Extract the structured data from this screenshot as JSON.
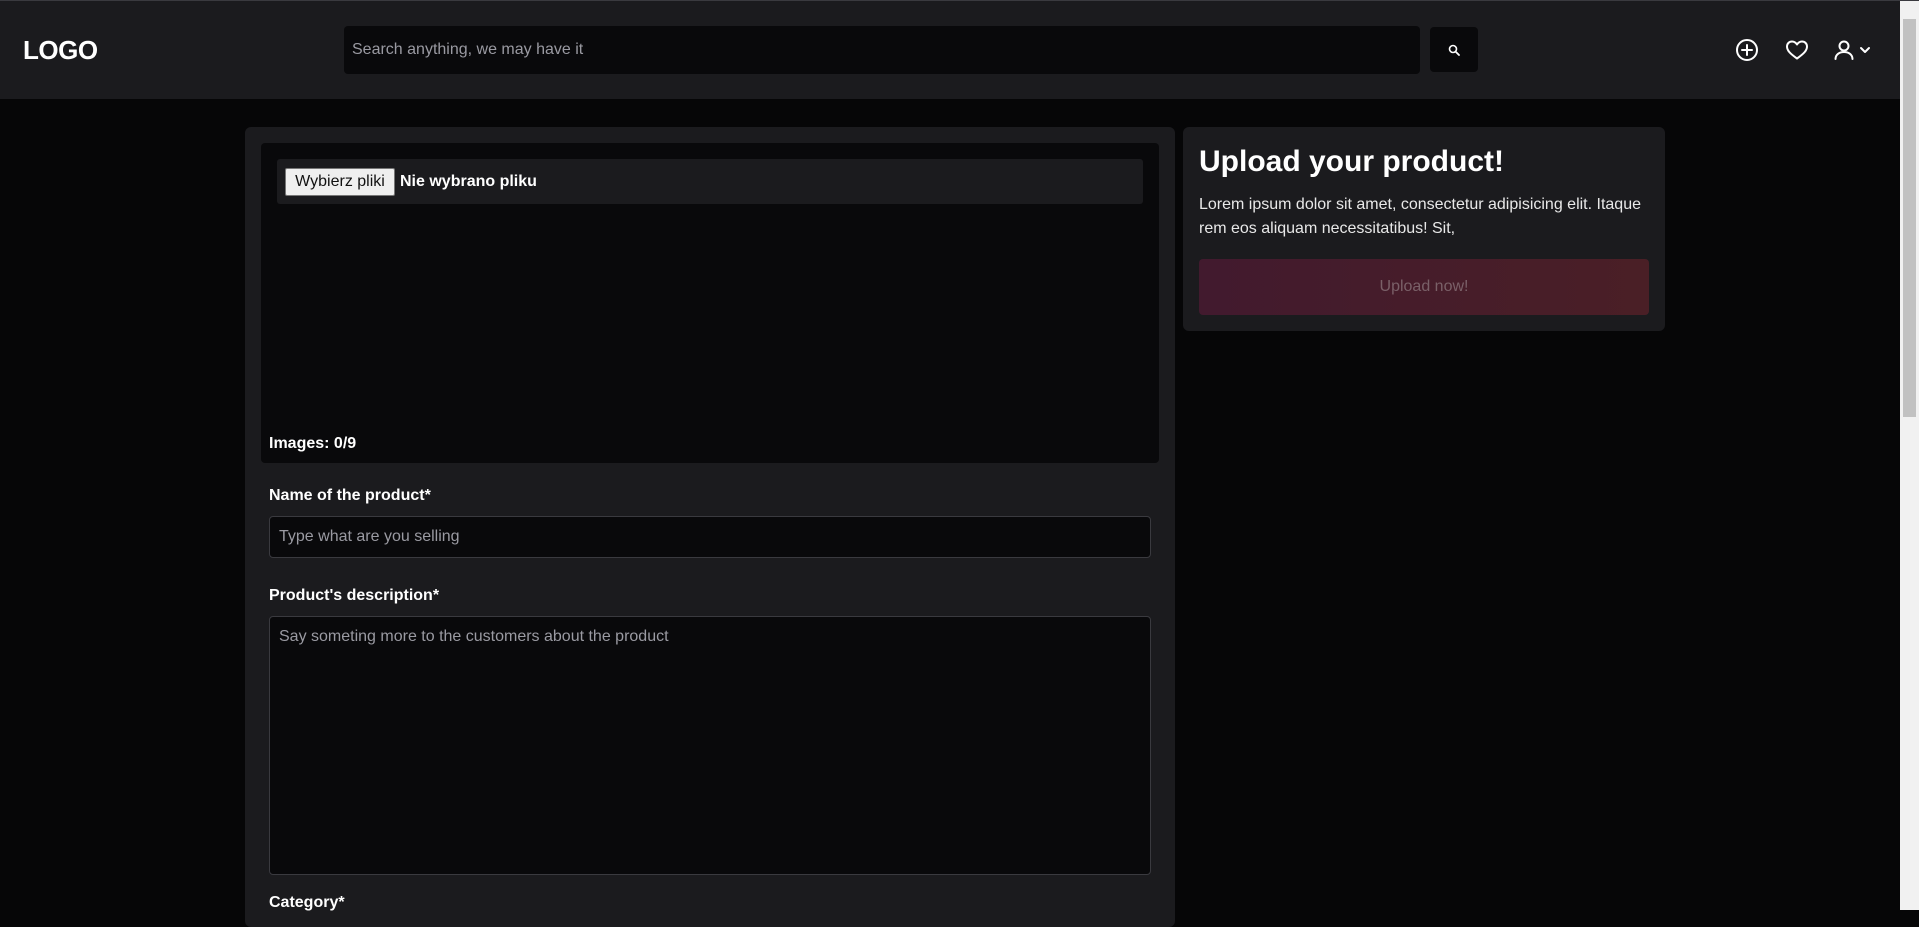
{
  "header": {
    "logo": "LOGO",
    "search_placeholder": "Search anything, we may have it",
    "icons": [
      "search-icon",
      "add-circle-icon",
      "heart-icon",
      "user-icon",
      "chevron-down-icon"
    ]
  },
  "upload": {
    "file_button_label": "Wybierz pliki",
    "file_status": "Nie wybrano pliku",
    "images_count": "Images: 0/9"
  },
  "form": {
    "name_label": "Name of the product*",
    "name_placeholder": "Type what are you selling",
    "description_label": "Product's description*",
    "description_placeholder": "Say someting more to the customers about the product",
    "category_label": "Category*"
  },
  "sidebar": {
    "title": "Upload your product!",
    "text": "Lorem ipsum dolor sit amet, consectetur adipisicing elit. Itaque rem eos aliquam necessitatibus! Sit,",
    "button_label": "Upload now!"
  },
  "colors": {
    "background": "#060607",
    "panel": "#1b1b1e",
    "input": "#09090b",
    "accent_gradient_start": "#421a2e",
    "accent_gradient_end": "#4a1f26"
  }
}
